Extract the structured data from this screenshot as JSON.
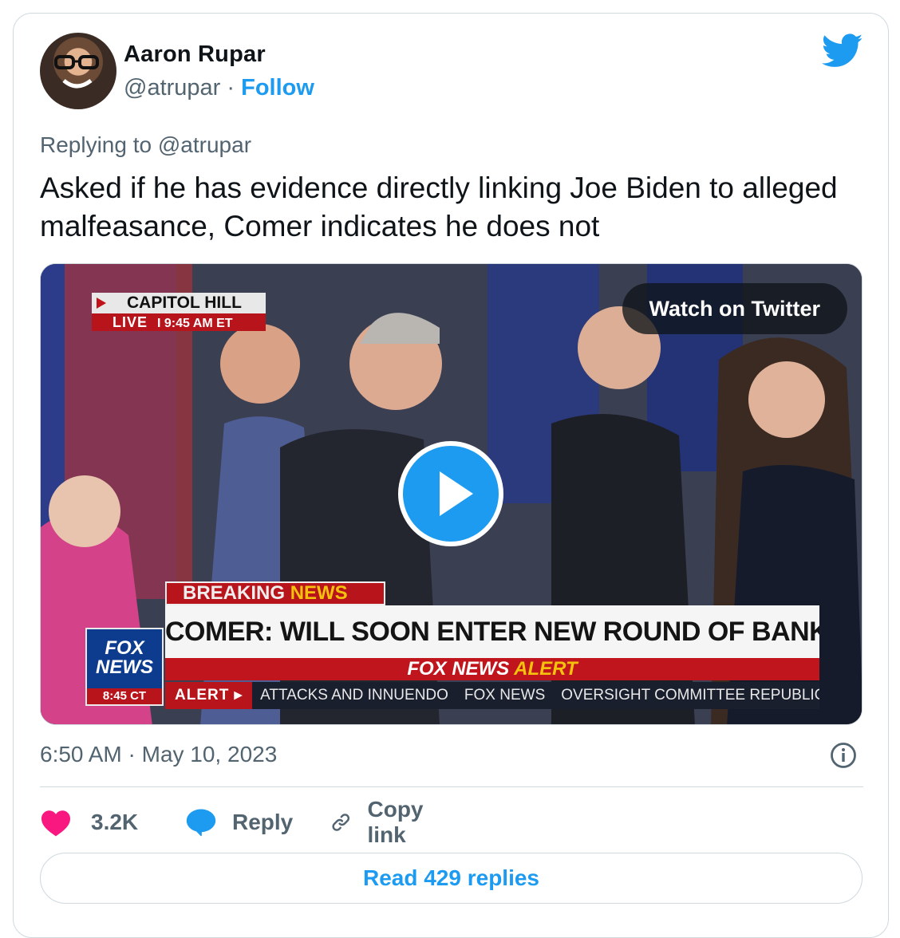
{
  "author": {
    "display_name": "Aaron Rupar",
    "handle": "@atrupar",
    "separator": "·",
    "follow_label": "Follow"
  },
  "reply": {
    "prefix": "Replying to",
    "mention": "@atrupar"
  },
  "tweet_text": "Asked if he has evidence directly linking Joe Biden to alleged malfeasance, Comer indicates he does not",
  "media": {
    "watch_label": "Watch on Twitter",
    "overlay": {
      "location": "CAPITOL HILL",
      "live": "LIVE",
      "live_time": "I  9:45 AM ET",
      "breaking_1": "BREAKING",
      "breaking_2": "NEWS",
      "headline": "COMER: WILL SOON ENTER NEW ROUND OF BANK SUBPOENAS",
      "alert_1": "FOX NEWS",
      "alert_2": "ALERT",
      "ticker_label": "ALERT ▸",
      "ticker_1": "ATTACKS AND INNUENDO",
      "ticker_2": "FOX NEWS",
      "ticker_3": "OVERSIGHT COMMITTEE REPUBLICAN",
      "logo_1": "FOX",
      "logo_2": "NEWS",
      "logo_time": "8:45 CT"
    }
  },
  "timestamp": "6:50 AM · May 10, 2023",
  "actions": {
    "likes": "3.2K",
    "reply": "Reply",
    "copy_link": "Copy link"
  },
  "read_replies": "Read 429 replies",
  "colors": {
    "twitter_blue": "#1d9bf0",
    "heart": "#f91880",
    "muted": "#536471",
    "border": "#cfd9de"
  },
  "icons": [
    "twitter-bird-icon",
    "play-icon",
    "info-icon",
    "heart-icon",
    "reply-bubble-icon",
    "link-icon"
  ]
}
